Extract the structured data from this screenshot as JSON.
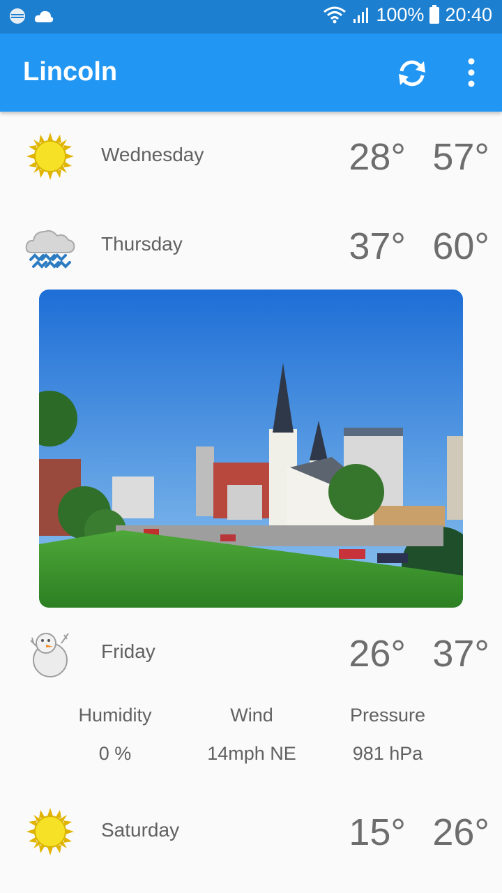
{
  "status_bar": {
    "battery": "100%",
    "time": "20:40"
  },
  "toolbar": {
    "title": "Lincoln"
  },
  "forecast": [
    {
      "day": "Wednesday",
      "icon": "sun-icon",
      "low": "28°",
      "high": "57°"
    },
    {
      "day": "Thursday",
      "icon": "rain-cloud-icon",
      "low": "37°",
      "high": "60°"
    },
    {
      "day": "Friday",
      "icon": "snowman-icon",
      "low": "26°",
      "high": "37°"
    },
    {
      "day": "Saturday",
      "icon": "sun-icon",
      "low": "15°",
      "high": "26°"
    }
  ],
  "details": {
    "humidity_label": "Humidity",
    "humidity_value": "0 %",
    "wind_label": "Wind",
    "wind_value": "14mph NE",
    "pressure_label": "Pressure",
    "pressure_value": "981 hPa"
  },
  "colors": {
    "toolbar": "#2196f3",
    "statusbar": "#1d7fcf",
    "background": "#fafafa",
    "text": "#616161"
  }
}
